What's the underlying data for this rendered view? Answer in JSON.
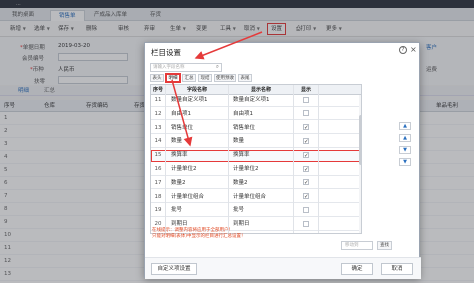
{
  "app": {
    "title": "...",
    "tabs": [
      {
        "label": "我的桌面"
      },
      {
        "label": "销售单"
      },
      {
        "label": "产成品入库单"
      },
      {
        "label": "存货"
      }
    ],
    "toolbar": [
      {
        "label": "新增"
      },
      {
        "label": "选单"
      },
      {
        "label": "保存"
      },
      {
        "label": "删除"
      },
      {
        "label": "审核"
      },
      {
        "label": "弃审"
      },
      {
        "label": "生单"
      },
      {
        "label": "变更"
      },
      {
        "label": "工具"
      },
      {
        "label": "取消"
      },
      {
        "label": "设置"
      },
      {
        "label": "打印"
      },
      {
        "label": "更多"
      }
    ],
    "form": {
      "date_label": "单据日期",
      "date_value": "2019-03-20",
      "member_label": "会员编号",
      "customer_label": "客户",
      "customer_value": "人民币",
      "customer_prefix": "币种",
      "saler_label": "扶零",
      "right_link": "客户",
      "right_label": "运费"
    },
    "subtabs": [
      {
        "label": "明细"
      },
      {
        "label": "汇总"
      }
    ],
    "grid_headers": [
      {
        "label": "序号"
      },
      {
        "label": "仓库"
      },
      {
        "label": "存货编码"
      },
      {
        "label": "存货名称"
      },
      {
        "label": "单品毛利"
      }
    ],
    "row_numbers": [
      "1",
      "2",
      "3",
      "4",
      "5",
      "6",
      "7",
      "8",
      "9",
      "10",
      "11",
      "12",
      "13"
    ]
  },
  "dialog": {
    "title": "栏目设置",
    "help_label": "?",
    "close_label": "×",
    "search_placeholder": "请输入字段名称",
    "tabs": [
      {
        "label": "表头"
      },
      {
        "label": "明细"
      },
      {
        "label": "汇总"
      },
      {
        "label": "现结"
      },
      {
        "label": "使用预收"
      },
      {
        "label": "表尾"
      }
    ],
    "columns": [
      "序号",
      "字段名称",
      "显示名称",
      "显示"
    ],
    "rows": [
      {
        "no": "11",
        "field": "数量自定义项1",
        "display": "数量自定义项1",
        "checked": false
      },
      {
        "no": "12",
        "field": "自由项1",
        "display": "自由项1",
        "checked": false
      },
      {
        "no": "13",
        "field": "销售单位",
        "display": "销售单位",
        "checked": true
      },
      {
        "no": "14",
        "field": "数量",
        "display": "数量",
        "checked": true
      },
      {
        "no": "15",
        "field": "换算率",
        "display": "换算率",
        "checked": true
      },
      {
        "no": "16",
        "field": "计量单位2",
        "display": "计量单位2",
        "checked": true
      },
      {
        "no": "17",
        "field": "数量2",
        "display": "数量2",
        "checked": true
      },
      {
        "no": "18",
        "field": "计量单位组合",
        "display": "计量单位组合",
        "checked": true
      },
      {
        "no": "19",
        "field": "批号",
        "display": "批号",
        "checked": false
      },
      {
        "no": "20",
        "field": "到期日",
        "display": "到期日",
        "checked": false
      }
    ],
    "arrows": [
      "▲",
      "▲",
      "▼",
      "▼"
    ],
    "note_line1": "在线提示：调整内容将应用于全部用户！",
    "note_line2": "只能对明细(表体)中显示的栏目进行汇总设置！",
    "finder_placeholder": "移动到",
    "finder_button": "查找",
    "footer": {
      "custom_button": "自定义项设置",
      "ok_button": "确定",
      "cancel_button": "取消"
    }
  }
}
